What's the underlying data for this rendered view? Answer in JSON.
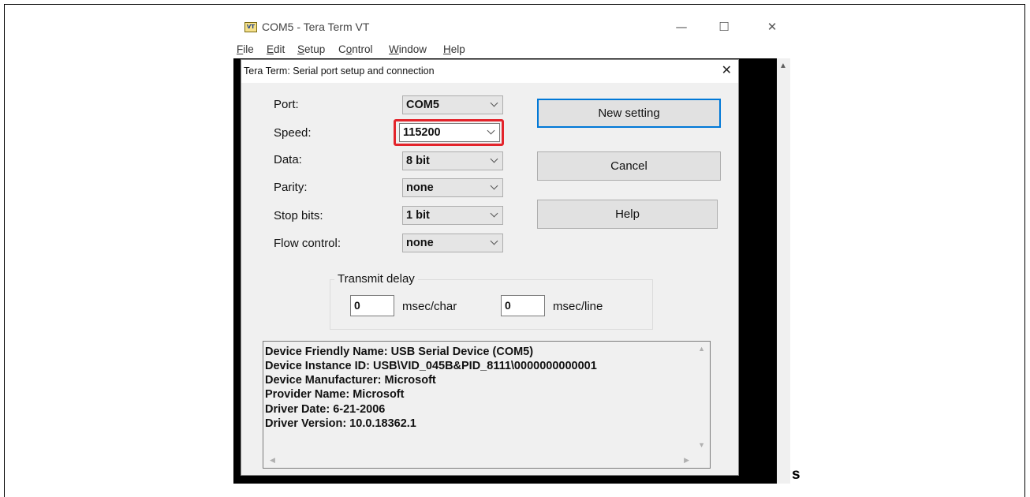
{
  "window": {
    "title": "COM5 - Tera Term VT",
    "app_icon": "VT",
    "minimize_glyph": "—",
    "maximize_glyph": "☐",
    "close_glyph": "✕"
  },
  "menu": [
    {
      "u": "F",
      "rest": "ile"
    },
    {
      "u": "E",
      "rest": "dit"
    },
    {
      "u": "S",
      "rest": "etup"
    },
    {
      "pre": "C",
      "u": "o",
      "rest": "ntrol"
    },
    {
      "u": "W",
      "rest": "indow"
    },
    {
      "u": "H",
      "rest": "elp"
    }
  ],
  "dialog": {
    "title": "Tera Term: Serial port setup and connection",
    "close_glyph": "✕",
    "fields": {
      "port": {
        "label": "Port:",
        "value": "COM5"
      },
      "speed": {
        "label": "Speed:",
        "value": "115200"
      },
      "data": {
        "label": "Data:",
        "value": "8 bit"
      },
      "parity": {
        "label": "Parity:",
        "value": "none"
      },
      "stop_bits": {
        "label": "Stop bits:",
        "value": "1 bit"
      },
      "flow_control": {
        "label": "Flow control:",
        "value": "none"
      }
    },
    "buttons": {
      "new_setting": "New setting",
      "cancel": "Cancel",
      "help": "Help"
    },
    "transmit_delay": {
      "title": "Transmit delay",
      "char_value": "0",
      "char_unit": "msec/char",
      "line_value": "0",
      "line_unit": "msec/line"
    },
    "device_info": [
      "Device Friendly Name: USB Serial Device (COM5)",
      "Device Instance ID: USB\\VID_045B&PID_8111\\0000000000001",
      "Device Manufacturer: Microsoft",
      "Provider Name: Microsoft",
      "Driver Date: 6-21-2006",
      "Driver Version: 10.0.18362.1"
    ]
  },
  "stray_text": "s",
  "colors": {
    "highlight": "#e3242b",
    "default_button_border": "#0078d7",
    "dialog_bg": "#f0f0f0",
    "terminal_bg": "#000000"
  }
}
